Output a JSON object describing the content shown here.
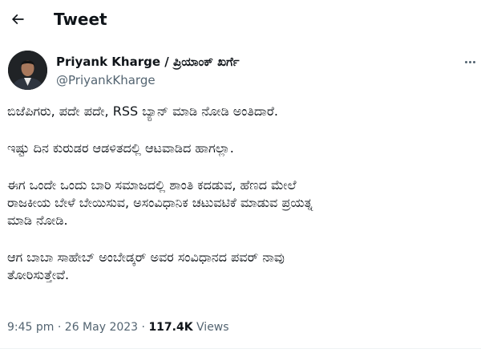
{
  "header": {
    "title": "Tweet",
    "back_icon": "arrow-left-icon"
  },
  "author": {
    "name": "Priyank Kharge / ಪ್ರಿಯಾಂಕ್ ಖರ್ಗೆ",
    "handle": "@PriyankKharge",
    "avatar_icon": "profile-photo"
  },
  "more_icon": "more-horizontal-icon",
  "tweet": {
    "paragraphs": [
      "ಬಿಜೆಪಿಗರು, ಪದೇ ಪದೇ, RSS ಬ್ಯಾನ್ ಮಾಡಿ ನೋಡಿ ಅಂತಿದಾರೆ.",
      "ಇಷ್ಟು ದಿನ ಕುರುಡರ ಆಡಳಿತದಲ್ಲಿ ಆಟವಾಡಿದ ಹಾಗಲ್ಲಾ.",
      "ಈಗ ಒಂದೇ ಒಂದು ಬಾರಿ ಸಮಾಜದಲ್ಲಿ ಶಾಂತಿ ಕದಡುವ, ಹೆಣದ ಮೇಲೆ\nರಾಜಕೀಯ ಬೇಳೆ ಬೇಯಿಸುವ, ಅಸಂವಿಧಾನಿಕ ಚಟುವಟಿಕೆ ಮಾಡುವ ಪ್ರಯತ್ನ\nಮಾಡಿ ನೋಡಿ.",
      "ಆಗ ಬಾಬಾ ಸಾಹೇಬ್ ಅಂಬೇಡ್ಕರ್ ಅವರ ಸಂವಿಧಾನದ ಪವರ್ ನಾವು\nತೋರಿಸುತ್ತೇವೆ."
    ]
  },
  "meta": {
    "time": "9:45 pm",
    "sep1": " · ",
    "date": "26 May 2023",
    "sep2": " · ",
    "views_count": "117.4K",
    "views_label": " Views"
  },
  "colors": {
    "text": "#0f1419",
    "secondary": "#536471",
    "divider": "#eff3f4"
  }
}
